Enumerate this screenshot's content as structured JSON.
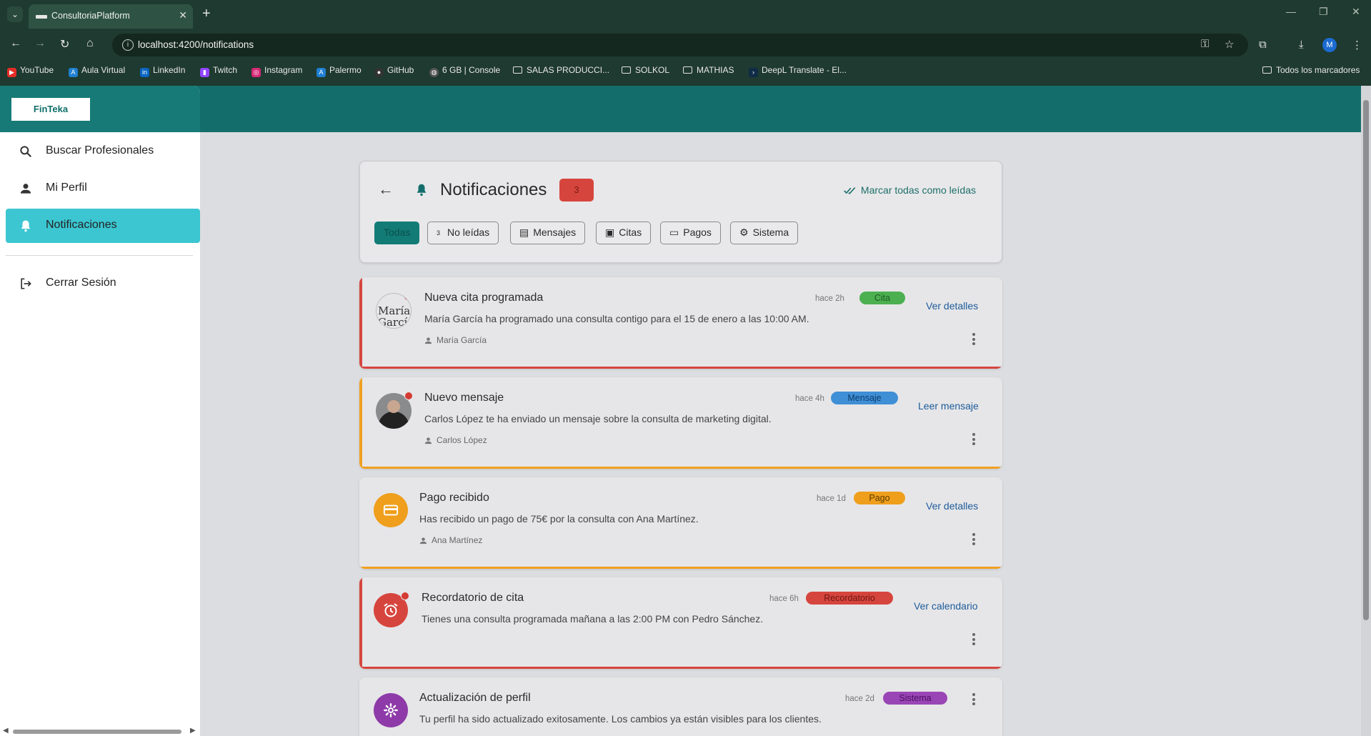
{
  "browser": {
    "tab_title": "ConsultoriaPlatform",
    "url": "localhost:4200/notifications",
    "profile_initial": "M",
    "bookmarks": [
      {
        "label": "YouTube",
        "icon": "youtube-icon",
        "color": "#e52d27"
      },
      {
        "label": "Aula Virtual",
        "icon": "aula-virtual-icon",
        "color": "#1f7fd1"
      },
      {
        "label": "LinkedIn",
        "icon": "linkedin-icon",
        "color": "#0a66c2"
      },
      {
        "label": "Twitch",
        "icon": "twitch-icon",
        "color": "#9146ff"
      },
      {
        "label": "Instagram",
        "icon": "instagram-icon",
        "color": "#d62976"
      },
      {
        "label": "Palermo",
        "icon": "palermo-icon",
        "color": "#1f7fd1"
      },
      {
        "label": "GitHub",
        "icon": "github-icon",
        "color": "#333333"
      },
      {
        "label": "6 GB | Console",
        "icon": "globe-icon",
        "color": "#555555"
      },
      {
        "label": "SALAS PRODUCCI...",
        "icon": "folder-icon"
      },
      {
        "label": "SOLKOL",
        "icon": "folder-icon"
      },
      {
        "label": "MATHIAS",
        "icon": "folder-icon"
      },
      {
        "label": "DeepL Translate - El...",
        "icon": "deepl-icon",
        "color": "#0f2b46"
      }
    ],
    "all_bookmarks": "Todos los marcadores"
  },
  "app": {
    "logo": "FinTeka",
    "nav": [
      {
        "label": "Buscar Profesionales",
        "icon": "search-icon"
      },
      {
        "label": "Mi Perfil",
        "icon": "person-icon"
      },
      {
        "label": "Notificaciones",
        "icon": "bell-icon",
        "active": true
      },
      {
        "label": "Cerrar Sesión",
        "icon": "logout-icon"
      }
    ]
  },
  "header": {
    "title": "Notificaciones",
    "unread_count": "3",
    "mark_all": "Marcar todas como leídas",
    "filters": [
      {
        "label": "Todas",
        "selected": true
      },
      {
        "label": "No leídas",
        "count": "3",
        "icon": ""
      },
      {
        "label": "Mensajes",
        "icon": "message-icon"
      },
      {
        "label": "Citas",
        "icon": "calendar-icon"
      },
      {
        "label": "Pagos",
        "icon": "credit-card-icon"
      },
      {
        "label": "Sistema",
        "icon": "gear-icon"
      }
    ]
  },
  "notifications": [
    {
      "title": "Nueva cita programada",
      "time": "hace 2h",
      "tag": "Cita",
      "message": "María García ha programado una consulta contigo para el 15 de enero a las 10:00 AM.",
      "user": "María García",
      "avatar_alt": "María García",
      "action": "Ver detalles",
      "unread": true,
      "accent": "#d6453d",
      "tag_color": "#4caf50",
      "tag_text_color": "#1b5e20"
    },
    {
      "title": "Nuevo mensaje",
      "time": "hace 4h",
      "tag": "Mensaje",
      "message": "Carlos López te ha enviado un mensaje sobre la consulta de marketing digital.",
      "user": "Carlos López",
      "action": "Leer mensaje",
      "unread": true,
      "accent": "#f0a020",
      "tag_color": "#3f8fd6",
      "tag_text_color": "#0d3d6b"
    },
    {
      "title": "Pago recibido",
      "time": "hace 1d",
      "tag": "Pago",
      "message": "Has recibido un pago de 75€ por la consulta con Ana Martínez.",
      "user": "Ana Martínez",
      "action": "Ver detalles",
      "unread": false,
      "accent": "#f0a020",
      "icon": "credit-card-icon",
      "icon_bg": "#ef9f1c",
      "tag_color": "#ef9f1c",
      "tag_text_color": "#5e3b00"
    },
    {
      "title": "Recordatorio de cita",
      "time": "hace 6h",
      "tag": "Recordatorio",
      "message": "Tienes una consulta programada mañana a las 2:00 PM con Pedro Sánchez.",
      "action": "Ver calendario",
      "unread": true,
      "accent": "#d6453d",
      "icon": "alarm-icon",
      "icon_bg": "#d6453d",
      "tag_color": "#d6453d",
      "tag_text_color": "#6d1612"
    },
    {
      "title": "Actualización de perfil",
      "time": "hace 2d",
      "tag": "Sistema",
      "message": "Tu perfil ha sido actualizado exitosamente. Los cambios ya están visibles para los clientes.",
      "unread": false,
      "icon": "gear-icon",
      "icon_bg": "#8e3aa8",
      "tag_color": "#9a45b6",
      "tag_text_color": "#4a0f60"
    }
  ]
}
